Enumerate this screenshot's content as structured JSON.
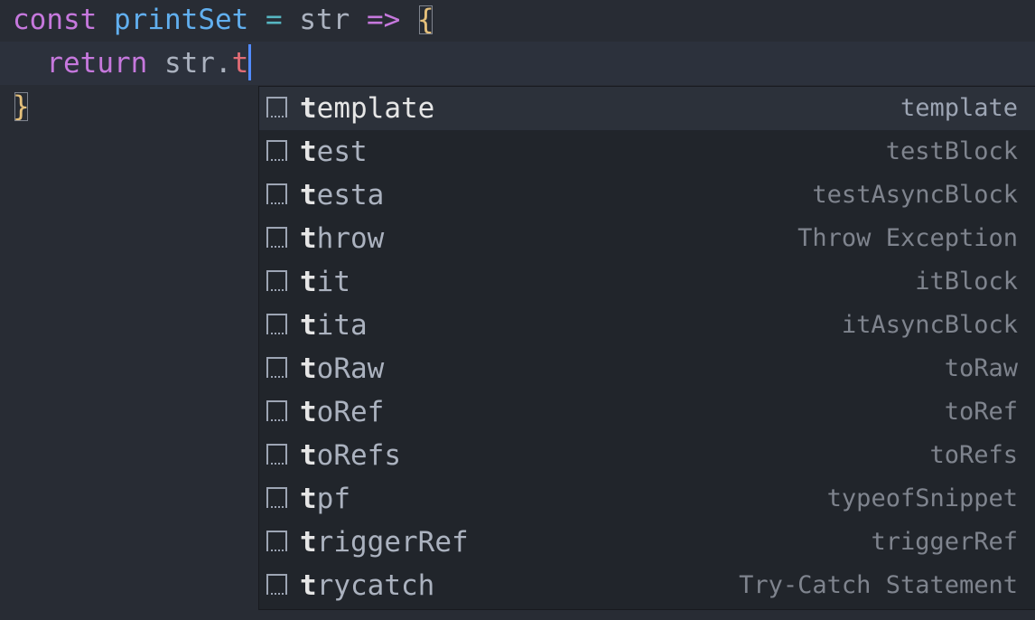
{
  "editor": {
    "line1": {
      "keyword": "const",
      "name": "printSet",
      "equals": "=",
      "param": "str",
      "arrow": "=>",
      "brace": "{"
    },
    "line2": {
      "keyword": "return",
      "object": "str.",
      "typed": "t"
    },
    "line3": {
      "brace": "}"
    }
  },
  "suggestions": [
    {
      "match": "t",
      "rest": "emplate",
      "detail": "template",
      "selected": true,
      "icon": "snippet-icon"
    },
    {
      "match": "t",
      "rest": "est",
      "detail": "testBlock",
      "icon": "snippet-icon"
    },
    {
      "match": "t",
      "rest": "esta",
      "detail": "testAsyncBlock",
      "icon": "snippet-icon"
    },
    {
      "match": "t",
      "rest": "hrow",
      "detail": "Throw Exception",
      "icon": "snippet-icon"
    },
    {
      "match": "t",
      "rest": "it",
      "detail": "itBlock",
      "icon": "snippet-icon"
    },
    {
      "match": "t",
      "rest": "ita",
      "detail": "itAsyncBlock",
      "icon": "snippet-icon"
    },
    {
      "match": "t",
      "rest": "oRaw",
      "detail": "toRaw",
      "icon": "snippet-icon"
    },
    {
      "match": "t",
      "rest": "oRef",
      "detail": "toRef",
      "icon": "snippet-icon"
    },
    {
      "match": "t",
      "rest": "oRefs",
      "detail": "toRefs",
      "icon": "snippet-icon"
    },
    {
      "match": "t",
      "rest": "pf",
      "detail": "typeofSnippet",
      "icon": "snippet-icon"
    },
    {
      "match": "t",
      "rest": "riggerRef",
      "detail": "triggerRef",
      "icon": "snippet-icon"
    },
    {
      "match": "t",
      "rest": "rycatch",
      "detail": "Try-Catch Statement",
      "icon": "snippet-icon"
    }
  ],
  "colors": {
    "background": "#282c34",
    "suggest_background": "#21252b",
    "keyword": "#c678dd",
    "function": "#61afef",
    "operator": "#56b6c2",
    "brace": "#e5c07b",
    "typed": "#e06c75",
    "cursor": "#528bff"
  }
}
